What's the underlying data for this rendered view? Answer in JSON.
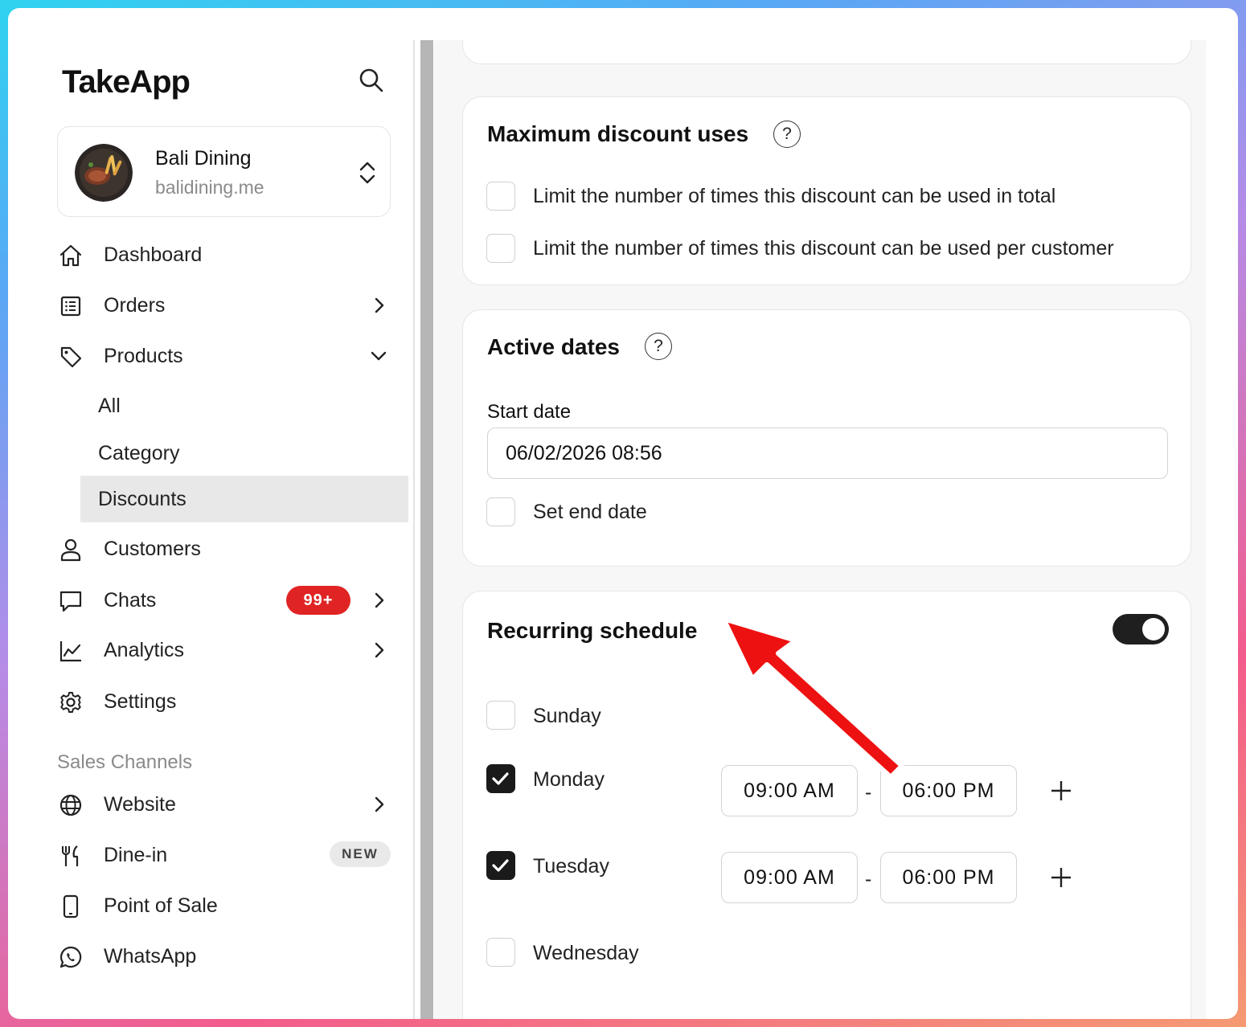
{
  "sidebar": {
    "logo": "TakeApp",
    "store": {
      "name": "Bali Dining",
      "url": "balidining.me"
    },
    "nav": {
      "dashboard": "Dashboard",
      "orders": "Orders",
      "products": "Products",
      "products_sub": {
        "all": "All",
        "category": "Category",
        "discounts": "Discounts"
      },
      "customers": "Customers",
      "chats": "Chats",
      "chats_badge": "99+",
      "analytics": "Analytics",
      "settings": "Settings"
    },
    "sales_channels": {
      "label": "Sales Channels",
      "website": "Website",
      "dine_in": "Dine-in",
      "dine_in_badge": "NEW",
      "pos": "Point of Sale",
      "whatsapp": "WhatsApp"
    },
    "active_item": "Discounts"
  },
  "main": {
    "max_uses": {
      "title": "Maximum discount uses",
      "help": "?",
      "options": [
        {
          "label": "Limit the number of times this discount can be used in total",
          "checked": false
        },
        {
          "label": "Limit the number of times this discount can be used per customer",
          "checked": false
        }
      ]
    },
    "active_dates": {
      "title": "Active dates",
      "help": "?",
      "start_label": "Start date",
      "start_value": "06/02/2026 08:56",
      "end_label": "Set end date",
      "end_checked": false
    },
    "recurring": {
      "title": "Recurring schedule",
      "enabled": true,
      "days": [
        {
          "label": "Sunday",
          "checked": false
        },
        {
          "label": "Monday",
          "checked": true,
          "from": "09:00 AM",
          "to": "06:00 PM"
        },
        {
          "label": "Tuesday",
          "checked": true,
          "from": "09:00 AM",
          "to": "06:00 PM"
        },
        {
          "label": "Wednesday",
          "checked": false
        }
      ],
      "separator": "-"
    }
  },
  "colors": {
    "accent": "#1a1a1a",
    "badge_red": "#e02424",
    "annotation_arrow": "#ee1111"
  }
}
